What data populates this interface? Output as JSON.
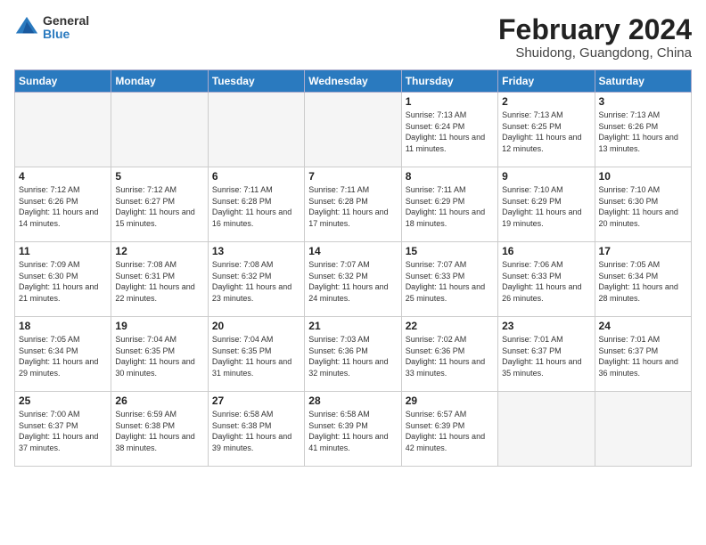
{
  "header": {
    "logo_general": "General",
    "logo_blue": "Blue",
    "month_year": "February 2024",
    "location": "Shuidong, Guangdong, China"
  },
  "days_of_week": [
    "Sunday",
    "Monday",
    "Tuesday",
    "Wednesday",
    "Thursday",
    "Friday",
    "Saturday"
  ],
  "weeks": [
    [
      {
        "day": "",
        "sunrise": "",
        "sunset": "",
        "daylight": ""
      },
      {
        "day": "",
        "sunrise": "",
        "sunset": "",
        "daylight": ""
      },
      {
        "day": "",
        "sunrise": "",
        "sunset": "",
        "daylight": ""
      },
      {
        "day": "",
        "sunrise": "",
        "sunset": "",
        "daylight": ""
      },
      {
        "day": "1",
        "sunrise": "7:13 AM",
        "sunset": "6:24 PM",
        "daylight": "11 hours and 11 minutes."
      },
      {
        "day": "2",
        "sunrise": "7:13 AM",
        "sunset": "6:25 PM",
        "daylight": "11 hours and 12 minutes."
      },
      {
        "day": "3",
        "sunrise": "7:13 AM",
        "sunset": "6:26 PM",
        "daylight": "11 hours and 13 minutes."
      }
    ],
    [
      {
        "day": "4",
        "sunrise": "7:12 AM",
        "sunset": "6:26 PM",
        "daylight": "11 hours and 14 minutes."
      },
      {
        "day": "5",
        "sunrise": "7:12 AM",
        "sunset": "6:27 PM",
        "daylight": "11 hours and 15 minutes."
      },
      {
        "day": "6",
        "sunrise": "7:11 AM",
        "sunset": "6:28 PM",
        "daylight": "11 hours and 16 minutes."
      },
      {
        "day": "7",
        "sunrise": "7:11 AM",
        "sunset": "6:28 PM",
        "daylight": "11 hours and 17 minutes."
      },
      {
        "day": "8",
        "sunrise": "7:11 AM",
        "sunset": "6:29 PM",
        "daylight": "11 hours and 18 minutes."
      },
      {
        "day": "9",
        "sunrise": "7:10 AM",
        "sunset": "6:29 PM",
        "daylight": "11 hours and 19 minutes."
      },
      {
        "day": "10",
        "sunrise": "7:10 AM",
        "sunset": "6:30 PM",
        "daylight": "11 hours and 20 minutes."
      }
    ],
    [
      {
        "day": "11",
        "sunrise": "7:09 AM",
        "sunset": "6:30 PM",
        "daylight": "11 hours and 21 minutes."
      },
      {
        "day": "12",
        "sunrise": "7:08 AM",
        "sunset": "6:31 PM",
        "daylight": "11 hours and 22 minutes."
      },
      {
        "day": "13",
        "sunrise": "7:08 AM",
        "sunset": "6:32 PM",
        "daylight": "11 hours and 23 minutes."
      },
      {
        "day": "14",
        "sunrise": "7:07 AM",
        "sunset": "6:32 PM",
        "daylight": "11 hours and 24 minutes."
      },
      {
        "day": "15",
        "sunrise": "7:07 AM",
        "sunset": "6:33 PM",
        "daylight": "11 hours and 25 minutes."
      },
      {
        "day": "16",
        "sunrise": "7:06 AM",
        "sunset": "6:33 PM",
        "daylight": "11 hours and 26 minutes."
      },
      {
        "day": "17",
        "sunrise": "7:05 AM",
        "sunset": "6:34 PM",
        "daylight": "11 hours and 28 minutes."
      }
    ],
    [
      {
        "day": "18",
        "sunrise": "7:05 AM",
        "sunset": "6:34 PM",
        "daylight": "11 hours and 29 minutes."
      },
      {
        "day": "19",
        "sunrise": "7:04 AM",
        "sunset": "6:35 PM",
        "daylight": "11 hours and 30 minutes."
      },
      {
        "day": "20",
        "sunrise": "7:04 AM",
        "sunset": "6:35 PM",
        "daylight": "11 hours and 31 minutes."
      },
      {
        "day": "21",
        "sunrise": "7:03 AM",
        "sunset": "6:36 PM",
        "daylight": "11 hours and 32 minutes."
      },
      {
        "day": "22",
        "sunrise": "7:02 AM",
        "sunset": "6:36 PM",
        "daylight": "11 hours and 33 minutes."
      },
      {
        "day": "23",
        "sunrise": "7:01 AM",
        "sunset": "6:37 PM",
        "daylight": "11 hours and 35 minutes."
      },
      {
        "day": "24",
        "sunrise": "7:01 AM",
        "sunset": "6:37 PM",
        "daylight": "11 hours and 36 minutes."
      }
    ],
    [
      {
        "day": "25",
        "sunrise": "7:00 AM",
        "sunset": "6:37 PM",
        "daylight": "11 hours and 37 minutes."
      },
      {
        "day": "26",
        "sunrise": "6:59 AM",
        "sunset": "6:38 PM",
        "daylight": "11 hours and 38 minutes."
      },
      {
        "day": "27",
        "sunrise": "6:58 AM",
        "sunset": "6:38 PM",
        "daylight": "11 hours and 39 minutes."
      },
      {
        "day": "28",
        "sunrise": "6:58 AM",
        "sunset": "6:39 PM",
        "daylight": "11 hours and 41 minutes."
      },
      {
        "day": "29",
        "sunrise": "6:57 AM",
        "sunset": "6:39 PM",
        "daylight": "11 hours and 42 minutes."
      },
      {
        "day": "",
        "sunrise": "",
        "sunset": "",
        "daylight": ""
      },
      {
        "day": "",
        "sunrise": "",
        "sunset": "",
        "daylight": ""
      }
    ]
  ]
}
